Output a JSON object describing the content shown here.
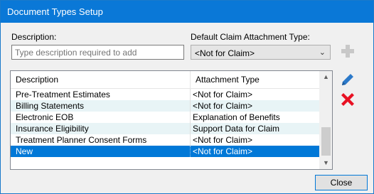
{
  "window": {
    "title": "Document Types Setup"
  },
  "form": {
    "description_label": "Description:",
    "description_placeholder": "Type description required to add",
    "attachment_label": "Default Claim Attachment Type:",
    "attachment_value": "<Not for Claim>"
  },
  "grid": {
    "columns": [
      "Description",
      "Attachment Type"
    ],
    "rows": [
      {
        "description": "Pre-Treatment Estimates",
        "attachment": "<Not for Claim>"
      },
      {
        "description": "Billing Statements",
        "attachment": "<Not for Claim>"
      },
      {
        "description": "Electronic EOB",
        "attachment": "Explanation of Benefits"
      },
      {
        "description": "Insurance Eligibility",
        "attachment": "Support Data for Claim"
      },
      {
        "description": "Treatment Planner Consent Forms",
        "attachment": "<Not for Claim>"
      },
      {
        "description": "New",
        "attachment": "<Not for Claim>"
      }
    ],
    "selected_row": 5
  },
  "buttons": {
    "close_label": "Close"
  },
  "icons": {
    "add": "plus-icon",
    "edit": "pencil-icon",
    "delete": "red-x-icon",
    "accent": "#0078d7",
    "delete_color": "#e81123"
  }
}
